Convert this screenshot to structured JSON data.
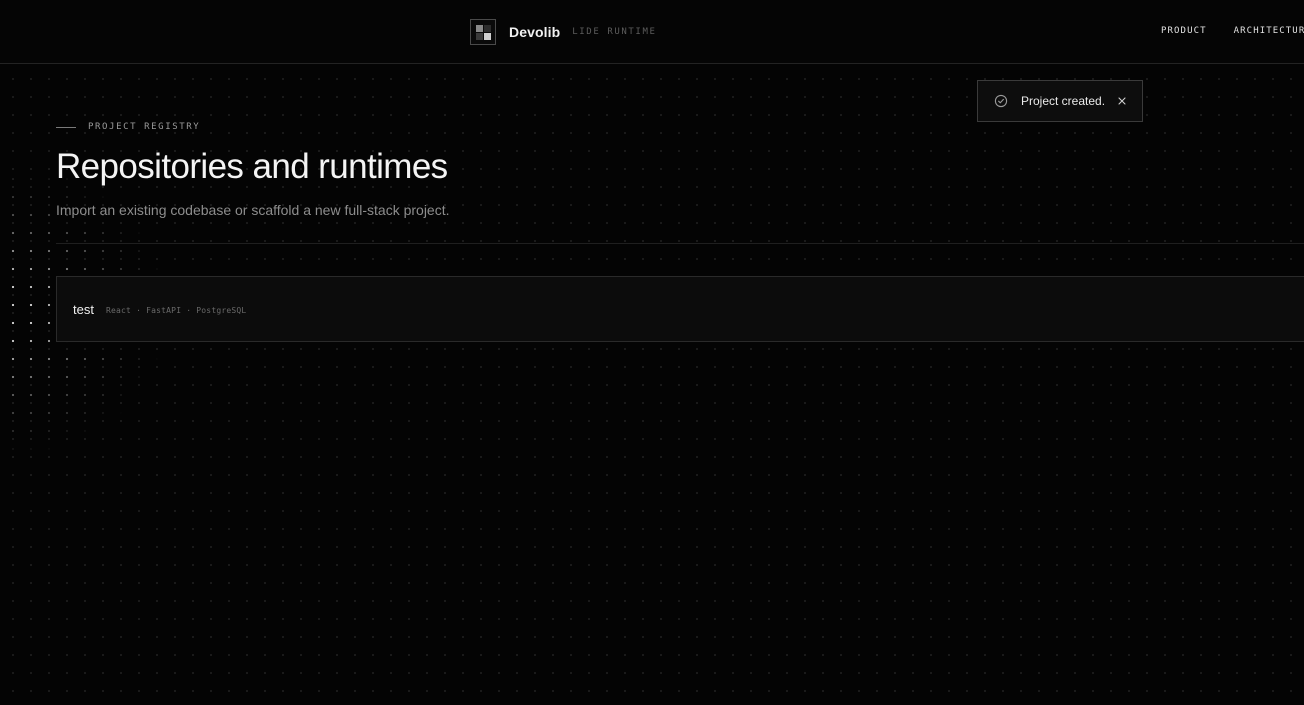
{
  "header": {
    "brand_name": "Devolib",
    "brand_tag": "LIDE RUNTIME",
    "nav": [
      {
        "label": "PRODUCT"
      },
      {
        "label": "ARCHITECTURE"
      }
    ]
  },
  "toast": {
    "message": "Project created.",
    "icon": "check-circle-icon",
    "close_icon": "close-icon"
  },
  "section": {
    "eyebrow": "PROJECT REGISTRY",
    "title": "Repositories and runtimes",
    "subtitle": "Import an existing codebase or scaffold a new full-stack project."
  },
  "projects": [
    {
      "name": "test",
      "stack": "React · FastAPI · PostgreSQL"
    }
  ],
  "colors": {
    "background": "#040404",
    "border": "#2a2a2a",
    "text": "#f0f0f0",
    "muted": "#8d8d8d"
  }
}
